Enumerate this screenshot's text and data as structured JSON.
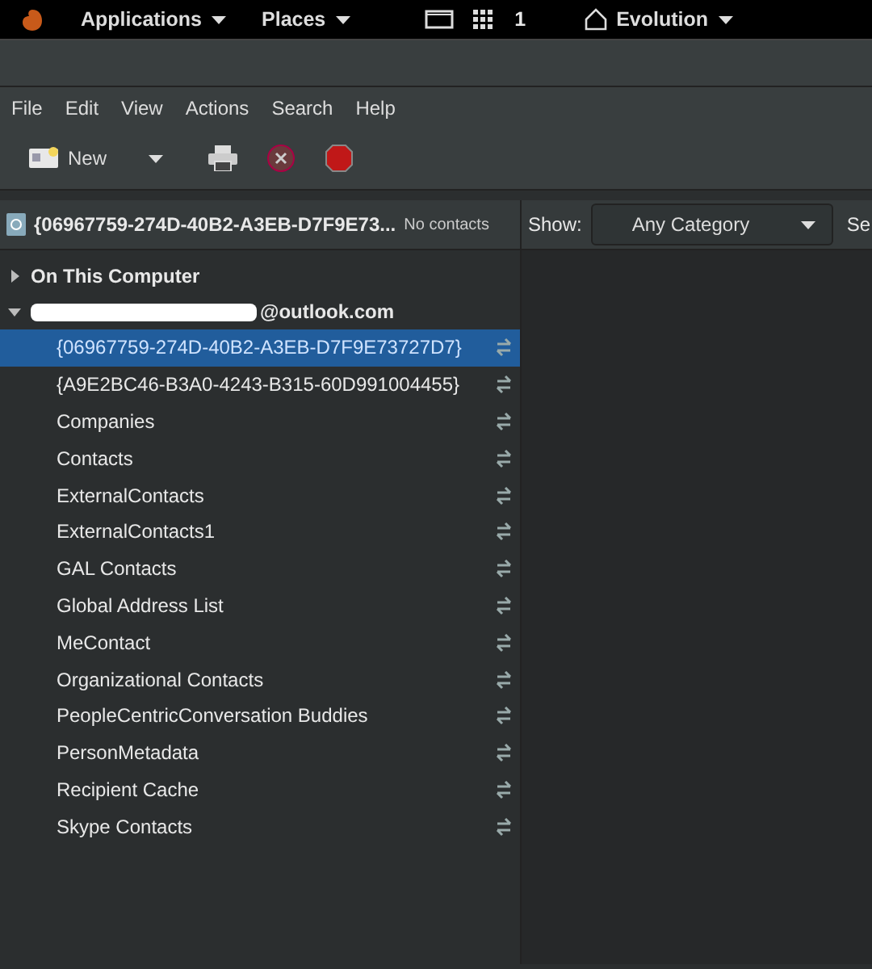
{
  "top_bar": {
    "menus": [
      {
        "label": "Applications"
      },
      {
        "label": "Places"
      }
    ],
    "workspace": "1",
    "app": "Evolution"
  },
  "menu_bar": [
    "File",
    "Edit",
    "View",
    "Actions",
    "Search",
    "Help"
  ],
  "toolbar": {
    "new_label": "New"
  },
  "header": {
    "book": "{06967759-274D-40B2-A3EB-D7F9E73...",
    "status": "No contacts",
    "show_label": "Show:",
    "category": "Any Category",
    "search_label": "Se"
  },
  "tree": [
    {
      "label": "On This Computer",
      "expanded": false,
      "redacted": false
    },
    {
      "label": "@outlook.com",
      "expanded": true,
      "redacted": true,
      "children": [
        {
          "label": "{06967759-274D-40B2-A3EB-D7F9E73727D7}",
          "selected": true
        },
        {
          "label": "{A9E2BC46-B3A0-4243-B315-60D991004455}",
          "selected": false
        },
        {
          "label": "Companies",
          "selected": false
        },
        {
          "label": "Contacts",
          "selected": false
        },
        {
          "label": "ExternalContacts",
          "selected": false
        },
        {
          "label": "ExternalContacts1",
          "selected": false
        },
        {
          "label": "GAL Contacts",
          "selected": false
        },
        {
          "label": "Global Address List",
          "selected": false
        },
        {
          "label": "MeContact",
          "selected": false
        },
        {
          "label": "Organizational Contacts",
          "selected": false
        },
        {
          "label": "PeopleCentricConversation Buddies",
          "selected": false
        },
        {
          "label": "PersonMetadata",
          "selected": false
        },
        {
          "label": "Recipient Cache",
          "selected": false
        },
        {
          "label": "Skype Contacts",
          "selected": false
        }
      ]
    }
  ]
}
